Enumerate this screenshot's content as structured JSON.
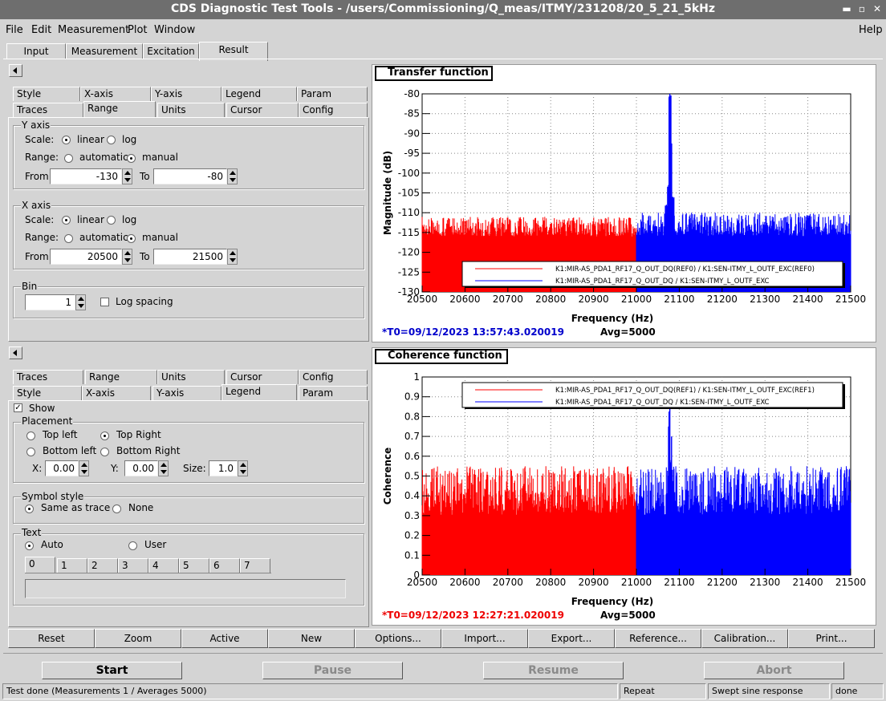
{
  "window": {
    "title": "CDS Diagnostic Test Tools - /users/Commissioning/Q_meas/ITMY/231208/20_5_21_5kHz",
    "min_icon": "minimize-icon",
    "max_icon": "maximize-icon",
    "close_icon": "close-icon",
    "min_glyph": "▬",
    "max_glyph": "▫",
    "close_glyph": "✕"
  },
  "menu": {
    "file": "File",
    "edit": "Edit",
    "measurement": "Measurement",
    "plot": "Plot",
    "window": "Window",
    "help": "Help"
  },
  "main_tabs": [
    "Input",
    "Measurement",
    "Excitation",
    "Result"
  ],
  "top_options": {
    "row1": [
      "Style",
      "X-axis",
      "Y-axis",
      "Legend",
      "Param"
    ],
    "row2": [
      "Traces",
      "Range",
      "Units",
      "Cursor",
      "Config"
    ],
    "yaxis": {
      "title": "Y axis",
      "scale": "Scale:",
      "linear": "linear",
      "log": "log",
      "range": "Range:",
      "automatic": "automatic",
      "manual": "manual",
      "from": "From",
      "from_val": "-130",
      "to": "To",
      "to_val": "-80"
    },
    "xaxis": {
      "title": "X axis",
      "scale": "Scale:",
      "linear": "linear",
      "log": "log",
      "range": "Range:",
      "automatic": "automatic",
      "manual": "manual",
      "from": "From",
      "from_val": "20500",
      "to": "To",
      "to_val": "21500"
    },
    "bin": {
      "title": "Bin",
      "value": "1",
      "log_spacing": "Log spacing"
    }
  },
  "bottom_options": {
    "row1": [
      "Traces",
      "Range",
      "Units",
      "Cursor",
      "Config"
    ],
    "row2": [
      "Style",
      "X-axis",
      "Y-axis",
      "Legend",
      "Param"
    ],
    "show": "Show",
    "placement": {
      "title": "Placement",
      "top_left": "Top left",
      "top_right": "Top Right",
      "bottom_left": "Bottom left",
      "bottom_right": "Bottom Right",
      "x": "X:",
      "x_val": "0.00",
      "y": "Y:",
      "y_val": "0.00",
      "size": "Size:",
      "size_val": "1.0"
    },
    "symbol": {
      "title": "Symbol style",
      "same": "Same as trace",
      "none": "None"
    },
    "text": {
      "title": "Text",
      "auto": "Auto",
      "user": "User",
      "tabs": [
        "0",
        "1",
        "2",
        "3",
        "4",
        "5",
        "6",
        "7"
      ]
    }
  },
  "plot_buttons": [
    "Reset",
    "Zoom",
    "Active",
    "New",
    "Options...",
    "Import...",
    "Export...",
    "Reference...",
    "Calibration...",
    "Print..."
  ],
  "control_buttons": {
    "start": "Start",
    "pause": "Pause",
    "resume": "Resume",
    "abort": "Abort"
  },
  "status": {
    "msg": "Test done (Measurements 1 / Averages 5000)",
    "mode": "Repeat",
    "type": "Swept sine response",
    "state": "done"
  },
  "colors": {
    "red": "#ff0000",
    "blue": "#0000ff",
    "t0_blue": "#0000cc",
    "t0_red": "#ee0000"
  },
  "chart_data": [
    {
      "type": "line",
      "title": "Transfer function",
      "xlabel": "Frequency (Hz)",
      "ylabel": "Magnitude (dB)",
      "xlim": [
        20500,
        21500
      ],
      "ylim": [
        -130,
        -80
      ],
      "xticks": [
        "20500",
        "20600",
        "20700",
        "20800",
        "20900",
        "21000",
        "21100",
        "21200",
        "21300",
        "21400",
        "21500"
      ],
      "yticks": [
        "-80",
        "-85",
        "-90",
        "-95",
        "-100",
        "-105",
        "-110",
        "-115",
        "-120",
        "-125",
        "-130"
      ],
      "legend": [
        "K1:MIR-AS_PDA1_RF17_Q_OUT_DQ(REF0) / K1:SEN-ITMY_L_OUTF_EXC(REF0)",
        "K1:MIR-AS_PDA1_RF17_Q_OUT_DQ / K1:SEN-ITMY_L_OUTF_EXC"
      ],
      "legend_position": "bottom-right",
      "grid": true,
      "series": [
        {
          "x_range": [
            20500,
            21000
          ],
          "baseline": -130,
          "level": -116,
          "noise_top": -111,
          "peaks": []
        },
        {
          "x_range": [
            21000,
            21500
          ],
          "baseline": -130,
          "level": -116,
          "noise_top": -110,
          "peaks": [
            [
              21070,
              -108
            ],
            [
              21075,
              -103
            ],
            [
              21078,
              -80
            ],
            [
              21080,
              -92
            ],
            [
              21085,
              -106
            ]
          ]
        }
      ],
      "t0": "*T0=09/12/2023 13:57:43.020019",
      "avg": "Avg=5000"
    },
    {
      "type": "line",
      "title": "Coherence function",
      "xlabel": "Frequency (Hz)",
      "ylabel": "Coherence",
      "xlim": [
        20500,
        21500
      ],
      "ylim": [
        0,
        1
      ],
      "xticks": [
        "20500",
        "20600",
        "20700",
        "20800",
        "20900",
        "21000",
        "21100",
        "21200",
        "21300",
        "21400",
        "21500"
      ],
      "yticks": [
        "1",
        "0.9",
        "0.8",
        "0.7",
        "0.6",
        "0.5",
        "0.4",
        "0.3",
        "0.2",
        "0.1",
        "0"
      ],
      "legend": [
        "K1:MIR-AS_PDA1_RF17_Q_OUT_DQ(REF1) / K1:SEN-ITMY_L_OUTF_EXC(REF1)",
        "K1:MIR-AS_PDA1_RF17_Q_OUT_DQ / K1:SEN-ITMY_L_OUTF_EXC"
      ],
      "legend_position": "top-right",
      "grid": true,
      "series": [
        {
          "x_range": [
            20500,
            21000
          ],
          "baseline": 0,
          "level": 0.3,
          "noise_top": 0.55,
          "peaks": []
        },
        {
          "x_range": [
            21000,
            21500
          ],
          "baseline": 0,
          "level": 0.3,
          "noise_top": 0.55,
          "peaks": [
            [
              21075,
              0.75
            ],
            [
              21078,
              0.85
            ],
            [
              21082,
              0.7
            ]
          ]
        }
      ],
      "t0": "*T0=09/12/2023 12:27:21.020019",
      "avg": "Avg=5000"
    }
  ]
}
